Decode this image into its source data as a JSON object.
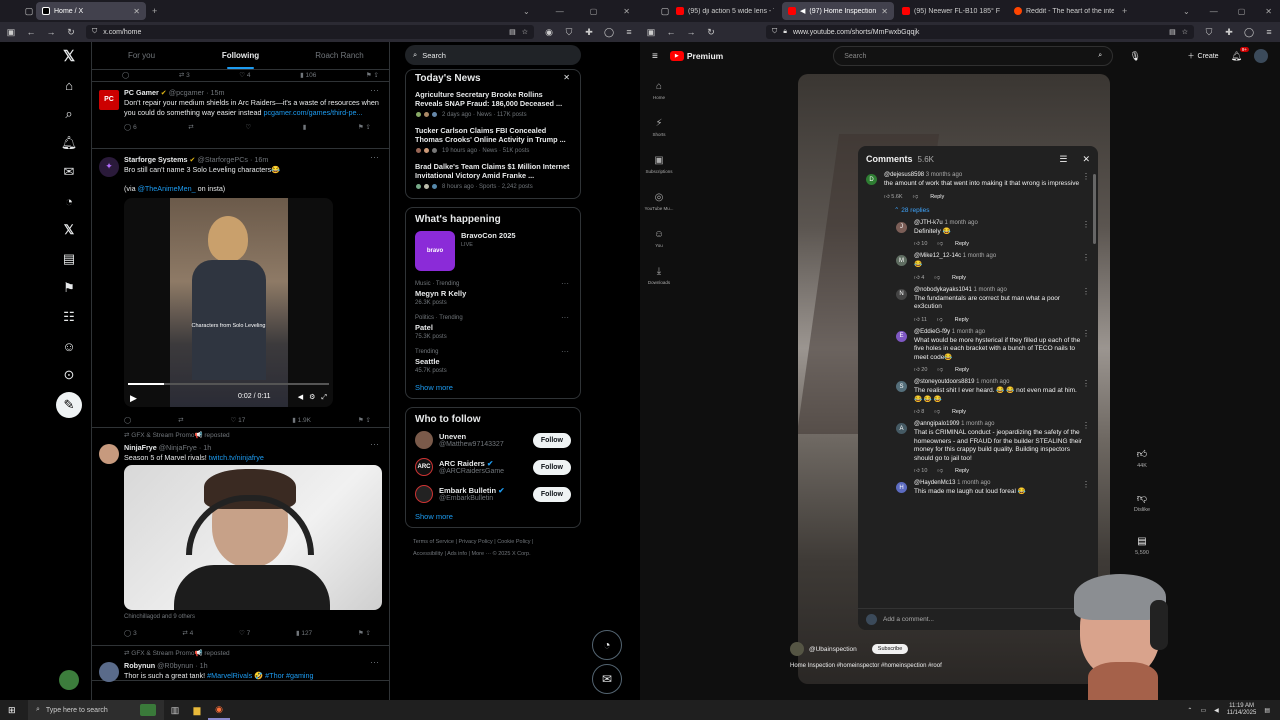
{
  "left_browser": {
    "tabs": [
      {
        "title": "Home / X",
        "favicon": "x-logo"
      }
    ],
    "url": "x.com/home"
  },
  "x": {
    "feed_tabs": [
      "For you",
      "Following",
      "Roach Ranch"
    ],
    "top_actions": {
      "replies": "",
      "reposts": "3",
      "likes": "4",
      "views": "106"
    },
    "posts": [
      {
        "name": "PC Gamer",
        "handle": "@pcgamer",
        "time": "15m",
        "text": "Don't repair your medium shields in Arc Raiders—it's a waste of resources when you could do something way easier instead",
        "link": "pcgamer.com/games/third-pe...",
        "replies": "6",
        "reposts": "",
        "likes": "",
        "views": ""
      },
      {
        "name": "Starforge Systems",
        "handle": "@StarforgePCs",
        "time": "16m",
        "text": "Bro still can't name 3 Solo Leveling characters😂",
        "via_prefix": "(via ",
        "via_link": "@TheAnimeMen_",
        "via_suffix": " on insta)",
        "video_caption": "Characters from Solo Leveling",
        "video_time": "0:02 / 0:11",
        "replies": "",
        "reposts": "",
        "likes": "17",
        "views": "1.9K"
      },
      {
        "repost_by": "GFX & Stream Promo📢 reposted",
        "name": "NinjaFrye",
        "handle": "@NinjaFrye",
        "time": "1h",
        "text": "Season 5 of Marvel rivals!",
        "link": "twitch.tv/ninjafrye",
        "liked_by": "Chinchillagod and 9 others",
        "replies": "3",
        "reposts": "4",
        "likes": "7",
        "views": "127"
      },
      {
        "repost_by": "GFX & Stream Promo📢 reposted",
        "name": "Robynun",
        "handle": "@R0bynun",
        "time": "1h",
        "text": "Thor is such a great tank!",
        "tags": "#MarvelRivals 🤣 #Thor #gaming"
      }
    ],
    "search_placeholder": "Search",
    "todays_news": {
      "title": "Today's News",
      "items": [
        {
          "headline": "Agriculture Secretary Brooke Rollins Reveals SNAP Fraud: 186,000 Deceased ...",
          "meta": "2 days ago · News · 117K posts"
        },
        {
          "headline": "Tucker Carlson Claims FBI Concealed Thomas Crooks' Online Activity in Trump ...",
          "meta": "19 hours ago · News · 51K posts"
        },
        {
          "headline": "Brad Dalke's Team Claims $1 Million Internet Invitational Victory Amid Franke ...",
          "meta": "8 hours ago · Sports · 2,242 posts"
        }
      ]
    },
    "whats_happening": {
      "title": "What's happening",
      "event": {
        "name": "BravoCon 2025",
        "status": "LIVE"
      },
      "trends": [
        {
          "context": "Music · Trending",
          "topic": "Megyn R Kelly",
          "count": "26.3K posts"
        },
        {
          "context": "Politics · Trending",
          "topic": "Patel",
          "count": "75.3K posts"
        },
        {
          "context": "Trending",
          "topic": "Seattle",
          "count": "45.7K posts"
        }
      ],
      "show_more": "Show more"
    },
    "who_to_follow": {
      "title": "Who to follow",
      "accounts": [
        {
          "name": "Uneven",
          "handle": "@Matthew97143327",
          "button": "Follow"
        },
        {
          "name": "ARC Raiders",
          "handle": "@ARCRaidersGame",
          "button": "Follow"
        },
        {
          "name": "Embark Bulletin",
          "handle": "@EmbarkBulletin",
          "button": "Follow"
        }
      ],
      "show_more": "Show more"
    },
    "footer": [
      "Terms of Service",
      "Privacy Policy",
      "Cookie Policy",
      "Accessibility",
      "Ads info",
      "More ···",
      "© 2025 X Corp."
    ]
  },
  "right_browser": {
    "tabs": [
      {
        "title": "(95) dji action 5 wide lens - You",
        "favicon": "youtube"
      },
      {
        "title": "(97) Home Inspection #hor",
        "favicon": "youtube"
      },
      {
        "title": "(95) Neewer FL-B10 185° FOV E",
        "favicon": "youtube"
      },
      {
        "title": "Reddit - The heart of the intern",
        "favicon": "reddit"
      }
    ],
    "url": "www.youtube.com/shorts/MmFwxbGqqjk"
  },
  "youtube": {
    "logo": "Premium",
    "search_placeholder": "Search",
    "create_label": "Create",
    "notif_count": "9+",
    "sidebar": [
      "Home",
      "Shorts",
      "Subscriptions",
      "YouTube Mu...",
      "You",
      "Downloads"
    ],
    "comments_title": "Comments",
    "comments_count": "5.6K",
    "top_comment": {
      "user": "@dejesus8598",
      "time": "3 months ago",
      "text": "the amount of work that went into making it that wrong is impressive",
      "likes": "5.6K",
      "reply": "Reply"
    },
    "replies_label": "28 replies",
    "replies": [
      {
        "user": "@JTH-k7u",
        "time": "1 month ago",
        "text": "Definitely 😂",
        "likes": "10",
        "initial": "J",
        "color": "#7b5e57"
      },
      {
        "user": "@Mike12_12-14c",
        "time": "1 month ago",
        "text": "😂",
        "likes": "4",
        "initial": "M",
        "color": "#5f6d61"
      },
      {
        "user": "@nobodykayaks1041",
        "time": "1 month ago",
        "text": "The fundamentals are correct but man what a poor ex3cution",
        "likes": "11",
        "initial": "N",
        "color": "#444"
      },
      {
        "user": "@EddieG-f9y",
        "time": "1 month ago",
        "text": "What would be more hysterical if they filled up each of the five holes in each bracket with a bunch of TECO nails to meet code😂",
        "likes": "20",
        "initial": "E",
        "color": "#7e57c2"
      },
      {
        "user": "@stoneyoutdoors8819",
        "time": "1 month ago",
        "text": "The realist shit I ever heard. 😂 😂 not even mad at him. 😂 😂 😂",
        "likes": "8",
        "initial": "S",
        "color": "#546e7a"
      },
      {
        "user": "@anngipalo1909",
        "time": "1 month ago",
        "text": "That is CRIMINAL conduct - jeopardizing the safety of the homeowners - and FRAUD for the builder STEALING their money for this crappy build quality.  Building inspectors should go to jail too!",
        "likes": "10",
        "initial": "A",
        "color": "#455a64"
      },
      {
        "user": "@HaydenMc13",
        "time": "1 month ago",
        "text": "This made me laugh out loud foreal 😂",
        "likes": "",
        "initial": "H",
        "color": "#5c6bc0"
      }
    ],
    "reply_label": "Reply",
    "add_comment": "Add a comment...",
    "channel": "@Ubainspection",
    "subscribe": "Subscribe",
    "hashtags": "Home Inspection #homeinspector #homeinspection #roof",
    "side_actions": [
      {
        "icon": "like",
        "label": "44K"
      },
      {
        "icon": "dislike",
        "label": "Dislike"
      },
      {
        "icon": "comment",
        "label": "5,590"
      }
    ]
  },
  "taskbar": {
    "search_placeholder": "Type here to search",
    "time": "11:19 AM",
    "date": "11/14/2025"
  }
}
